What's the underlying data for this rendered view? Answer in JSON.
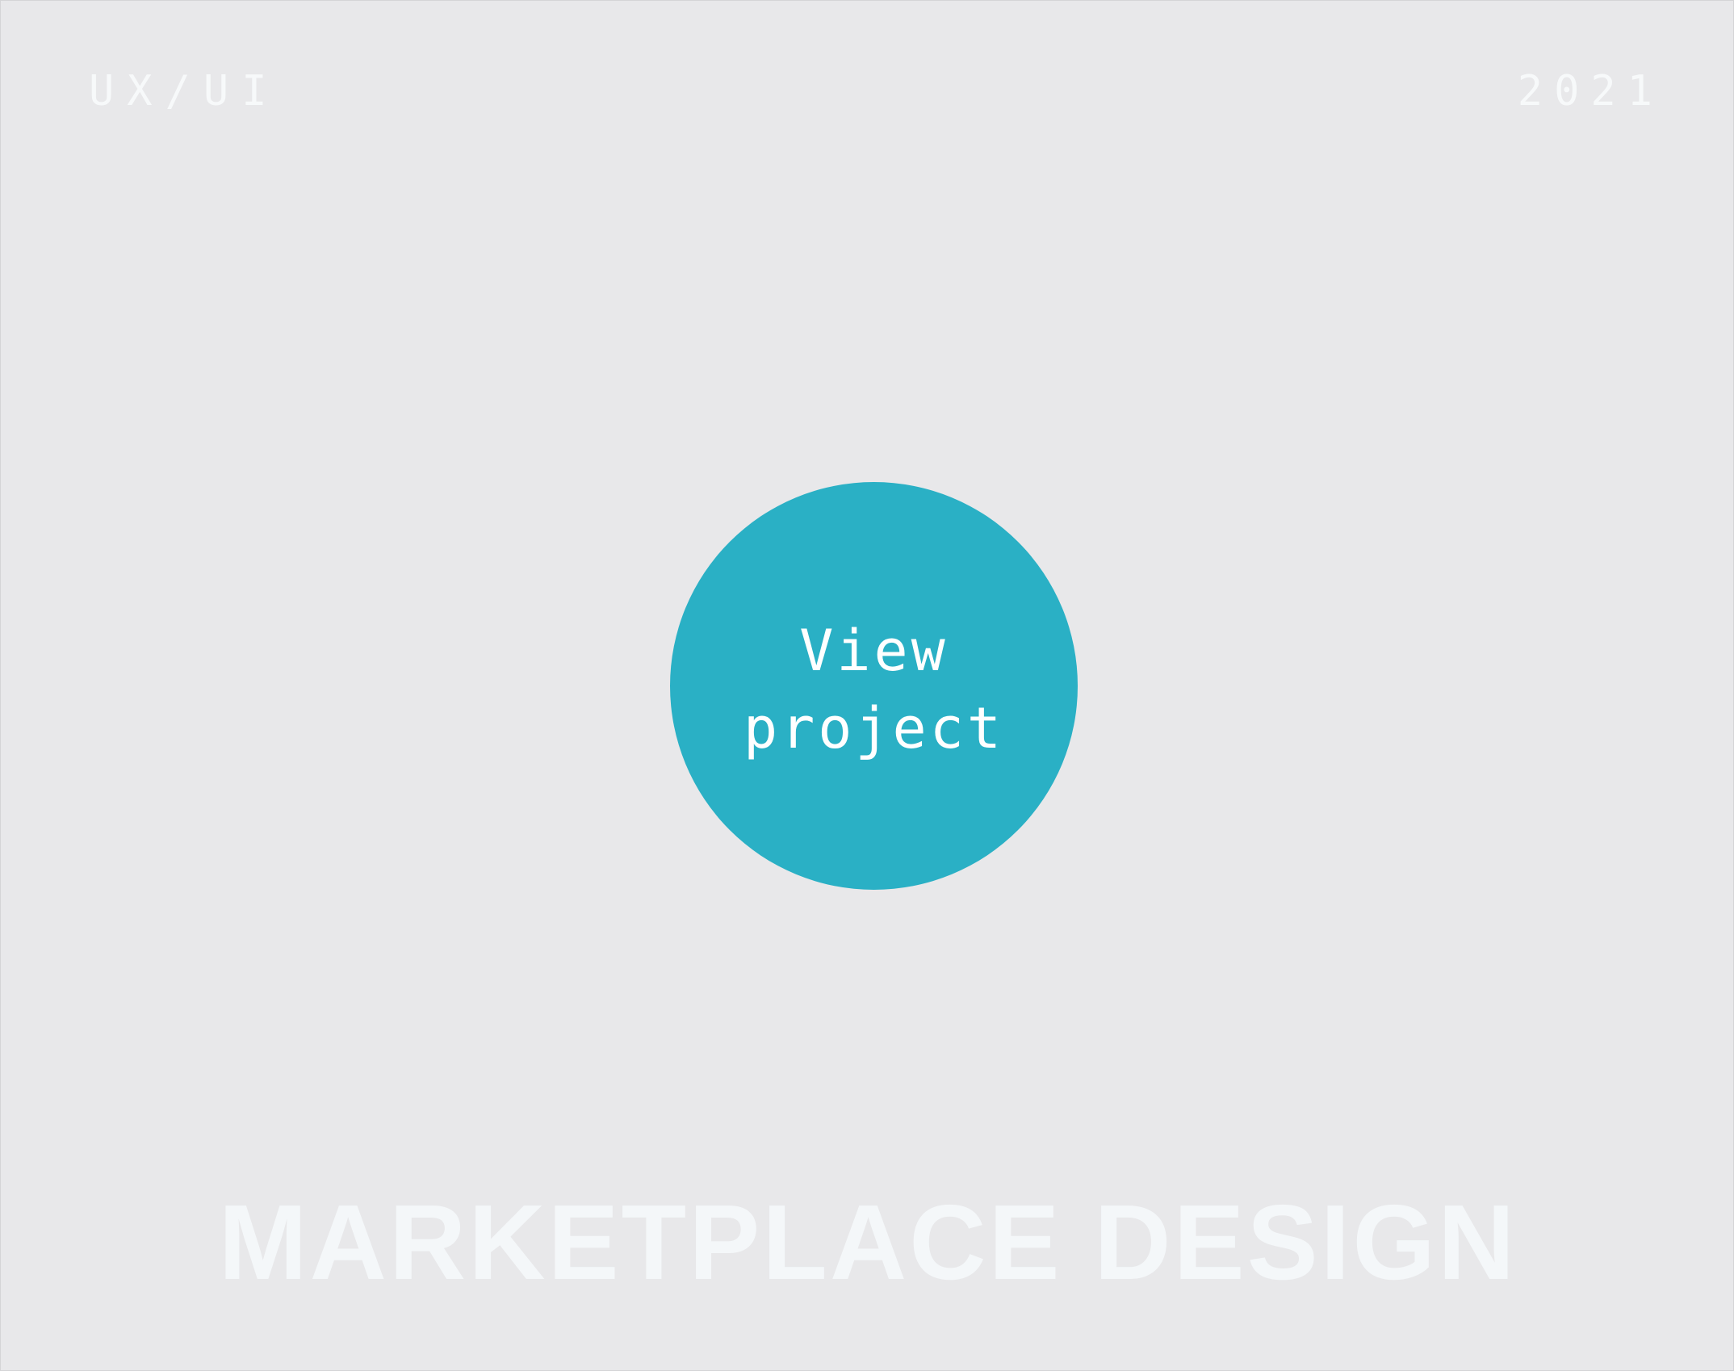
{
  "header": {
    "category": "UX/UI",
    "year": "2021"
  },
  "cta": {
    "label": "View\nproject"
  },
  "title": "MARKETPLACE DESIGN",
  "colors": {
    "background": "#e8e8ea",
    "accent": "#2ab0c5",
    "text": "#f4f7f9"
  }
}
